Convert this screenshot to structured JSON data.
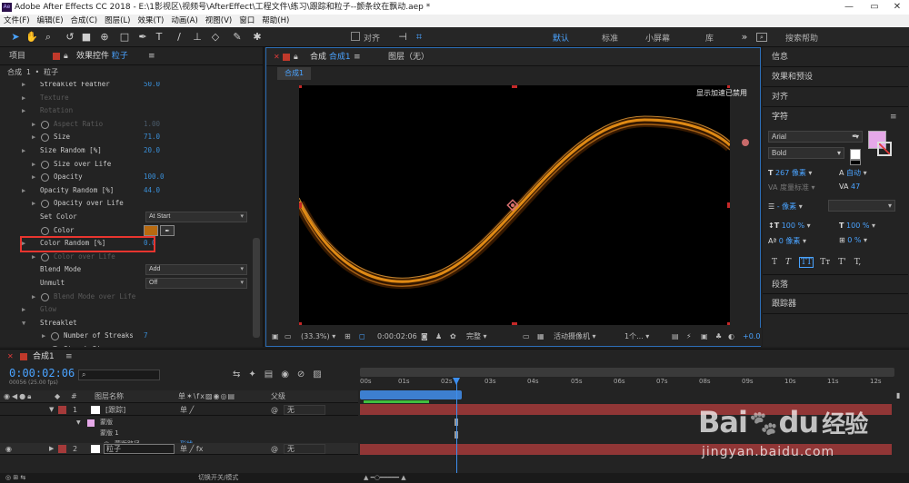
{
  "title": "Adobe After Effects CC 2018 - E:\\1影视区\\视频号\\AfterEffect\\工程文件\\练习\\跟踪和粒子--颤条纹在飘动.aep *",
  "ae_badge": "Ae",
  "menu": [
    "文件(F)",
    "编辑(E)",
    "合成(C)",
    "图层(L)",
    "效果(T)",
    "动画(A)",
    "视图(V)",
    "窗口",
    "帮助(H)"
  ],
  "toolbar": {
    "align": "对齐",
    "workspaces": [
      "默认",
      "标准",
      "小屏幕",
      "库"
    ],
    "search": "搜索帮助"
  },
  "left_panel": {
    "tab_project": "项目",
    "tab_effects": "效果控件",
    "tab_layer": "粒子",
    "breadcrumb": "合成 1 • 粒子"
  },
  "ec_rows": [
    {
      "label": "Streaklet Feather",
      "value": "50.0",
      "dim": false
    },
    {
      "label": "Texture",
      "value": "",
      "dim": true
    },
    {
      "label": "Rotation",
      "value": "",
      "dim": true
    },
    {
      "label": "Aspect Ratio",
      "value": "1.00",
      "dim": true
    },
    {
      "label": "Size",
      "value": "71.0",
      "dim": false
    },
    {
      "label": "Size Random [%]",
      "value": "20.0",
      "dim": false
    },
    {
      "label": "Size over Life",
      "value": "",
      "dim": false
    },
    {
      "label": "Opacity",
      "value": "100.0",
      "dim": false
    },
    {
      "label": "Opacity Random [%]",
      "value": "44.0",
      "dim": false
    },
    {
      "label": "Opacity over Life",
      "value": "",
      "dim": false
    },
    {
      "label": "Set Color",
      "value": "At Start",
      "dim": false
    },
    {
      "label": "Color",
      "value": "",
      "dim": false
    },
    {
      "label": "Color Random [%]",
      "value": "0.0",
      "dim": false
    },
    {
      "label": "Color over Life",
      "value": "",
      "dim": true
    },
    {
      "label": "Blend Mode",
      "value": "Add",
      "dim": false
    },
    {
      "label": "Unmult",
      "value": "Off",
      "dim": false
    },
    {
      "label": "Blend Mode over Life",
      "value": "",
      "dim": true
    },
    {
      "label": "Glow",
      "value": "",
      "dim": true
    },
    {
      "label": "Streaklet",
      "value": "",
      "dim": false
    },
    {
      "label": "Number of Streaks",
      "value": "7",
      "dim": false
    },
    {
      "label": "Streak Size",
      "value": "",
      "dim": false
    }
  ],
  "center": {
    "tab_comp": "合成",
    "tab_comp_name": "合成1",
    "tab_layer": "图层（无）",
    "sub_tab": "合成1",
    "accel": "显示加速已禁用",
    "zoom": "(33.3%)",
    "timecode": "0:00:02:06",
    "quality": "完整",
    "camera": "活动摄像机",
    "views": "1个...",
    "exposure": "+0.0"
  },
  "right_panel": {
    "items": [
      "信息",
      "效果和预设",
      "对齐",
      "字符",
      "段落",
      "跟踪器"
    ],
    "font": "Arial",
    "style": "Bold",
    "size": "267 像素",
    "leading": "自动",
    "tracking": "47",
    "kerning": "度量标准",
    "stroke_unit": "- 像素",
    "vscale": "100 %",
    "hscale": "100 %",
    "baseline": "0 像素",
    "tsume": "0 %",
    "text_style_buttons": [
      "T",
      "T",
      "TT",
      "Tт",
      "T'",
      "T,"
    ]
  },
  "timeline": {
    "tab": "合成1",
    "timecode": "0:00:02:06",
    "fps": "00056 (25.00 fps)",
    "col_layer": "图层名称",
    "col_parent": "父级",
    "switch_label": "切换开关/模式",
    "ruler": [
      "00s",
      "01s",
      "02s",
      "03s",
      "04s",
      "05s",
      "06s",
      "07s",
      "08s",
      "09s",
      "10s",
      "11s",
      "12s"
    ],
    "layers": [
      {
        "num": "1",
        "name": "[跟踪]",
        "parent": "无"
      },
      {
        "num": "2",
        "name": "粒子",
        "parent": "无"
      }
    ],
    "mask_group": "蒙版",
    "mask_item": "蒙版 1",
    "mask_path": "蒙版路径",
    "mask_path_value": "形状..."
  },
  "watermark": {
    "brand": "Bai",
    "brand2": "du",
    "brand3": "经验",
    "url": "jingyan.baidu.com"
  },
  "colors": {
    "accent": "#2d8ceb",
    "highlight": "#e8352f",
    "particle": "#e08a14",
    "swatch": "#b86a10",
    "lavender": "#e5a8e8",
    "layer_red": "#a53a3a"
  }
}
